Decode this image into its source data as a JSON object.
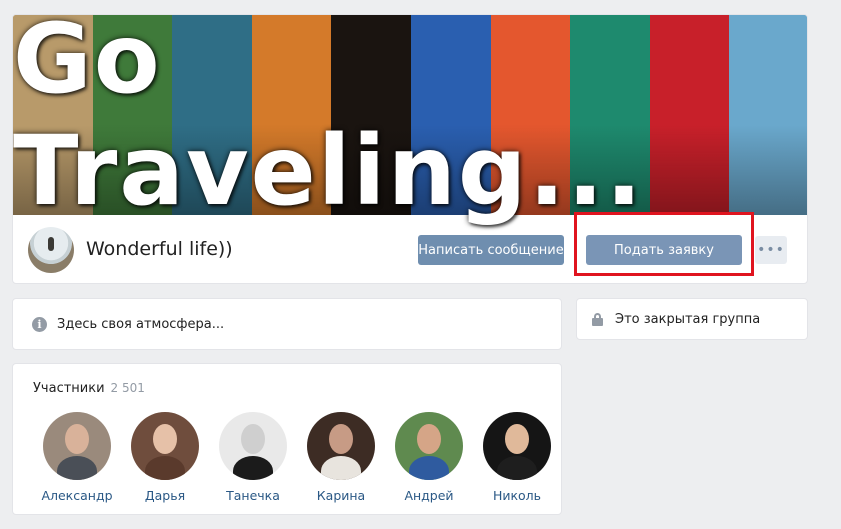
{
  "cover": {
    "title": "Go Traveling...",
    "strip_colors": [
      "#b89a6a",
      "#3f7a3a",
      "#2f6e86",
      "#d47a2a",
      "#1a1410",
      "#2a5fb0",
      "#e4572e",
      "#1e8a6e",
      "#c8202a",
      "#6aa8cc"
    ]
  },
  "group": {
    "name": "Wonderful life))",
    "message_button": "Написать сообщение",
    "request_button": "Подать заявку",
    "more_button": "•••"
  },
  "info": {
    "icon": "i",
    "description": "Здесь своя атмосфера..."
  },
  "closed_group": {
    "label": "Это закрытая группа"
  },
  "members": {
    "title": "Участники",
    "count": "2 501",
    "list": [
      {
        "name": "Александр"
      },
      {
        "name": "Дарья"
      },
      {
        "name": "Танечка"
      },
      {
        "name": "Карина"
      },
      {
        "name": "Андрей"
      },
      {
        "name": "Николь"
      }
    ]
  },
  "colors": {
    "primary_button": "#6f8eaf",
    "highlight": "#e0141f",
    "link": "#2a5885"
  }
}
